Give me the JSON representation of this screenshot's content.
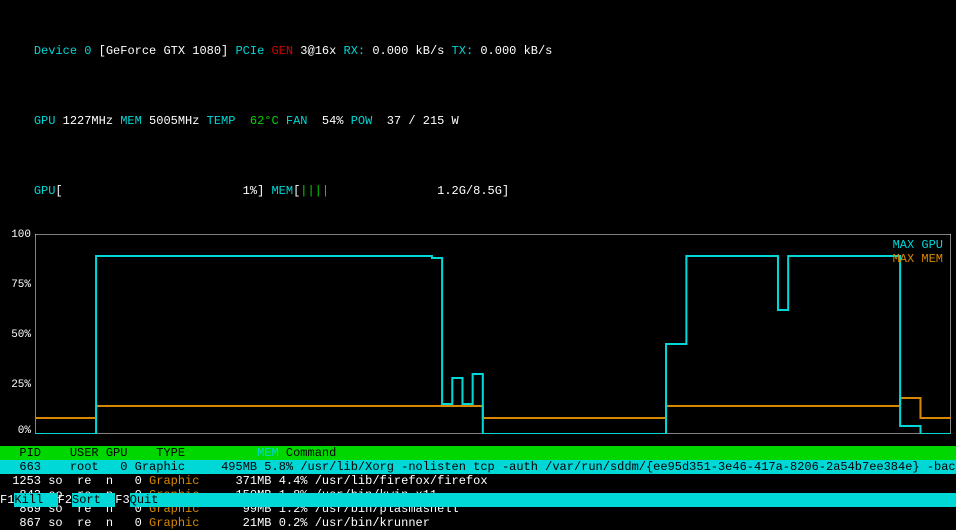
{
  "header": {
    "device_label": "Device ",
    "device_id": "0",
    "gpu_name": "[GeForce GTX 1080]",
    "pcie_label": " PCIe ",
    "gen_label": "GEN ",
    "gen_val": "3@16x ",
    "rx_label": "RX: ",
    "rx_val": "0.000 kB/s ",
    "tx_label": "TX: ",
    "tx_val": "0.000 kB/s",
    "gpu_label": "GPU ",
    "gpu_clock": "1227MHz ",
    "mem_label": "MEM ",
    "mem_clock": "5005MHz ",
    "temp_label": "TEMP  ",
    "temp_val": "62°C ",
    "fan_label": "FAN  ",
    "fan_val": "54% ",
    "pow_label": "POW  ",
    "pow_val": "37 / 215 W",
    "gpu_bar_label": "GPU",
    "gpu_bar_pct": "1%",
    "mem_bar_label": "MEM",
    "mem_bar_val": "1.2G/8.5G"
  },
  "chart_data": {
    "type": "line",
    "ylim": [
      0,
      100
    ],
    "yticks": [
      "100",
      "75%",
      "50%",
      "25%",
      "0%"
    ],
    "legend": {
      "gpu": "MAX GPU",
      "mem": "MAX MEM"
    },
    "gpu_series": [
      0,
      0,
      0,
      0,
      0,
      0,
      89,
      89,
      89,
      89,
      89,
      89,
      89,
      89,
      89,
      89,
      89,
      89,
      89,
      89,
      89,
      89,
      89,
      89,
      89,
      89,
      89,
      89,
      89,
      89,
      89,
      89,
      89,
      89,
      89,
      89,
      89,
      89,
      89,
      88,
      15,
      28,
      15,
      30,
      0,
      0,
      0,
      0,
      0,
      0,
      0,
      0,
      0,
      0,
      0,
      0,
      0,
      0,
      0,
      0,
      0,
      0,
      45,
      45,
      89,
      89,
      89,
      89,
      89,
      89,
      89,
      89,
      89,
      62,
      89,
      89,
      89,
      89,
      89,
      89,
      89,
      89,
      89,
      89,
      89,
      4,
      4,
      0,
      0,
      0
    ],
    "mem_series": [
      8,
      8,
      8,
      8,
      8,
      8,
      14,
      14,
      14,
      14,
      14,
      14,
      14,
      14,
      14,
      14,
      14,
      14,
      14,
      14,
      14,
      14,
      14,
      14,
      14,
      14,
      14,
      14,
      14,
      14,
      14,
      14,
      14,
      14,
      14,
      14,
      14,
      14,
      14,
      14,
      14,
      14,
      14,
      14,
      8,
      8,
      8,
      8,
      8,
      8,
      8,
      8,
      8,
      8,
      8,
      8,
      8,
      8,
      8,
      8,
      8,
      8,
      14,
      14,
      14,
      14,
      14,
      14,
      14,
      14,
      14,
      14,
      14,
      14,
      14,
      14,
      14,
      14,
      14,
      14,
      14,
      14,
      14,
      14,
      14,
      18,
      18,
      8,
      8,
      8
    ]
  },
  "table": {
    "headers": {
      "pid": "PID",
      "user": "USER",
      "gpu": "GPU",
      "type": "TYPE",
      "mem": "MEM",
      "command": "Command"
    },
    "rows": [
      {
        "pid": "663",
        "user": "root",
        "gpu": "0",
        "type": "Graphic",
        "mem": "495MB",
        "pct": "5.8%",
        "cmd": "/usr/lib/Xorg -nolisten tcp -auth /var/run/sddm/{ee95d351-3e46-417a-8206-2a54b7ee384e} -background none -noreset -di",
        "selected": true
      },
      {
        "pid": "1253",
        "user": "so  re  n",
        "gpu": "0",
        "type": "Graphic",
        "mem": "371MB",
        "pct": "4.4%",
        "cmd": "/usr/lib/firefox/firefox",
        "selected": false
      },
      {
        "pid": "843",
        "user": "so  re  n",
        "gpu": "0",
        "type": "Graphic",
        "mem": "150MB",
        "pct": "1.8%",
        "cmd": "/usr/bin/kwin_x11",
        "selected": false
      },
      {
        "pid": "869",
        "user": "so  re  n",
        "gpu": "0",
        "type": "Graphic",
        "mem": "99MB",
        "pct": "1.2%",
        "cmd": "/usr/bin/plasmashell",
        "selected": false
      },
      {
        "pid": "867",
        "user": "so  re  n",
        "gpu": "0",
        "type": "Graphic",
        "mem": "21MB",
        "pct": "0.2%",
        "cmd": "/usr/bin/krunner",
        "selected": false
      }
    ]
  },
  "fkeys": {
    "f1": "F1",
    "f1_label": "Kill  ",
    "f2": "F2",
    "f2_label": "Sort  ",
    "f3": "F3",
    "f3_label": "Quit"
  }
}
